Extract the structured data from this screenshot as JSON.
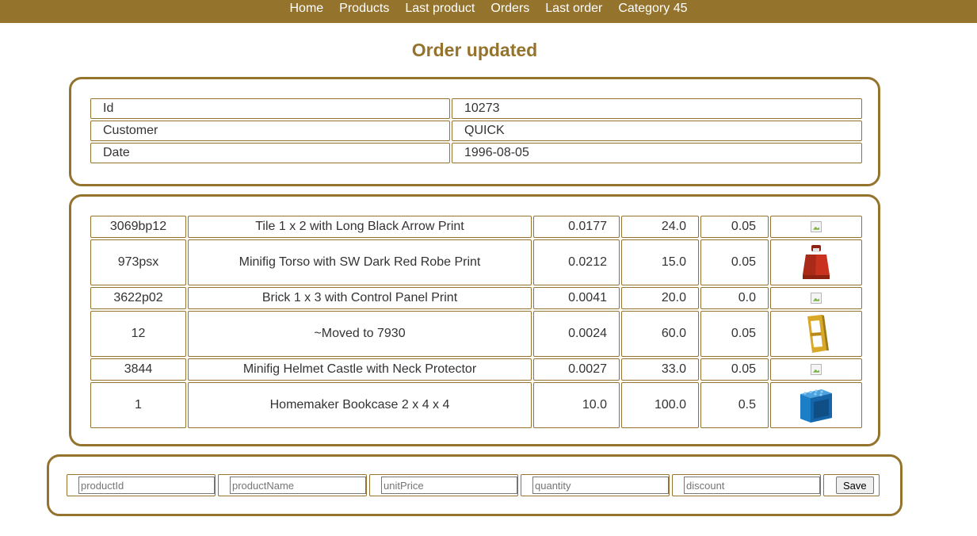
{
  "nav": {
    "items": [
      "Home",
      "Products",
      "Last product",
      "Orders",
      "Last order",
      "Category 45"
    ]
  },
  "page": {
    "title": "Order updated"
  },
  "order": {
    "rows": [
      {
        "label": "Id",
        "value": "10273"
      },
      {
        "label": "Customer",
        "value": "QUICK"
      },
      {
        "label": "Date",
        "value": "1996-08-05"
      }
    ]
  },
  "lines": [
    {
      "id": "3069bp12",
      "name": "Tile 1 x 2 with Long Black Arrow Print",
      "price": "0.0177",
      "qty": "24.0",
      "discount": "0.05",
      "image": "broken-image-icon"
    },
    {
      "id": "973psx",
      "name": "Minifig Torso with SW Dark Red Robe Print",
      "price": "0.0212",
      "qty": "15.0",
      "discount": "0.05",
      "image": "minifig-torso-red-icon"
    },
    {
      "id": "3622p02",
      "name": "Brick 1 x 3 with Control Panel Print",
      "price": "0.0041",
      "qty": "20.0",
      "discount": "0.0",
      "image": "broken-image-icon"
    },
    {
      "id": "12",
      "name": "~Moved to 7930",
      "price": "0.0024",
      "qty": "60.0",
      "discount": "0.05",
      "image": "yellow-door-frame-icon"
    },
    {
      "id": "3844",
      "name": "Minifig Helmet Castle with Neck Protector",
      "price": "0.0027",
      "qty": "33.0",
      "discount": "0.05",
      "image": "broken-image-icon"
    },
    {
      "id": "1",
      "name": "Homemaker Bookcase 2 x 4 x 4",
      "price": "10.0",
      "qty": "100.0",
      "discount": "0.5",
      "image": "blue-bookcase-icon"
    }
  ],
  "form": {
    "productId_placeholder": "productId",
    "productName_placeholder": "productName",
    "unitPrice_placeholder": "unitPrice",
    "quantity_placeholder": "quantity",
    "discount_placeholder": "discount",
    "save_label": "Save"
  },
  "colors": {
    "accent": "#94732d",
    "nav_text": "#ffffff",
    "torso_red": "#c8321e",
    "door_yellow": "#d9a826",
    "bookcase_blue": "#1d7ec8"
  }
}
